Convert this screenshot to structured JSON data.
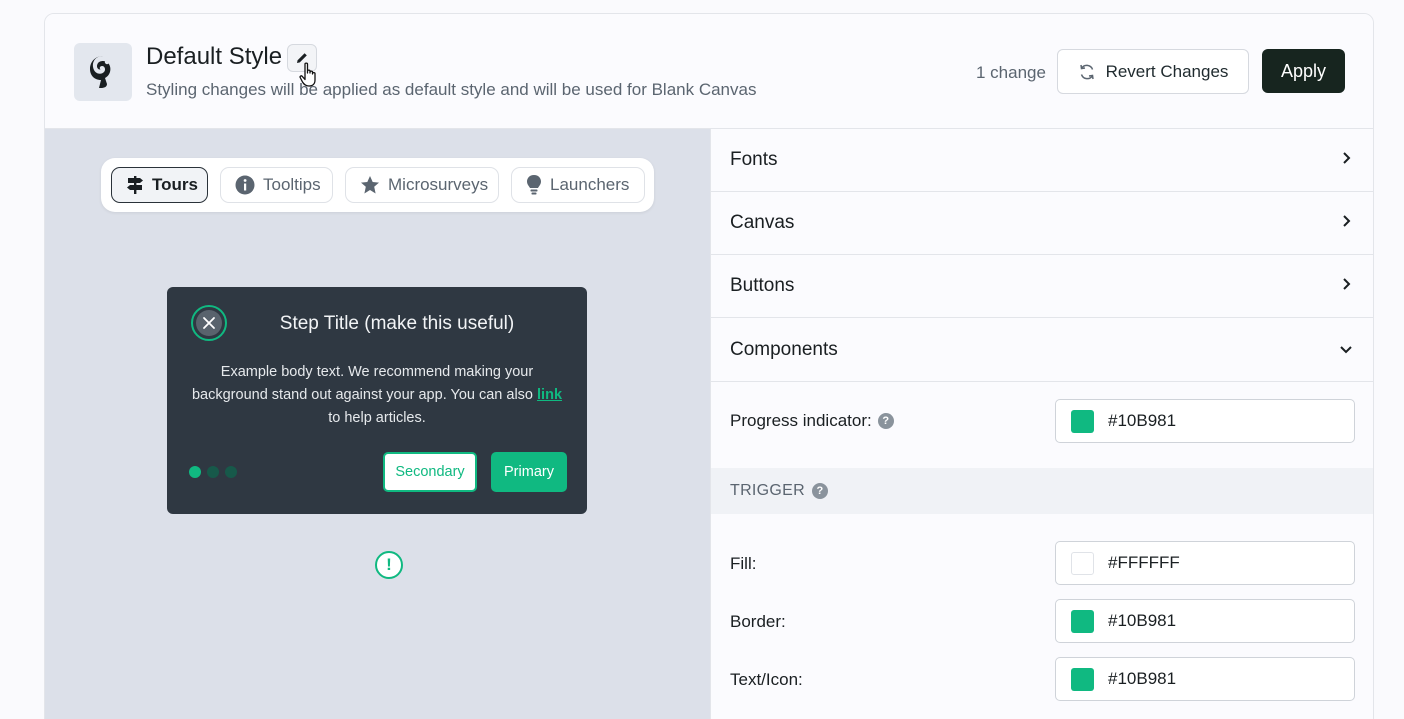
{
  "header": {
    "title": "Default Style",
    "subtitle": "Styling changes will be applied as default style and will be used for Blank Canvas",
    "change_count": "1 change",
    "revert_label": "Revert Changes",
    "apply_label": "Apply"
  },
  "preview": {
    "tabs": [
      {
        "label": "Tours",
        "icon": "signpost-icon",
        "active": true
      },
      {
        "label": "Tooltips",
        "icon": "info-icon",
        "active": false
      },
      {
        "label": "Microsurveys",
        "icon": "star-icon",
        "active": false
      },
      {
        "label": "Launchers",
        "icon": "lightbulb-icon",
        "active": false
      }
    ],
    "step": {
      "title": "Step Title (make this useful)",
      "body_before_link": "Example body text. We recommend making your background stand out against your app. You can also ",
      "link_text": "link",
      "body_after_link": " to help articles.",
      "secondary_label": "Secondary",
      "primary_label": "Primary",
      "progress_current": 1,
      "progress_total": 3
    },
    "trigger_symbol": "!"
  },
  "panel": {
    "sections": [
      {
        "label": "Fonts",
        "expanded": false
      },
      {
        "label": "Canvas",
        "expanded": false
      },
      {
        "label": "Buttons",
        "expanded": false
      },
      {
        "label": "Components",
        "expanded": true
      }
    ],
    "progress_indicator": {
      "label": "Progress indicator:",
      "value": "#10B981"
    },
    "trigger_heading": "TRIGGER",
    "trigger_fields": [
      {
        "label": "Fill:",
        "value": "#FFFFFF"
      },
      {
        "label": "Border:",
        "value": "#10B981"
      },
      {
        "label": "Text/Icon:",
        "value": "#10B981"
      }
    ]
  },
  "colors": {
    "accent": "#10B981",
    "apply_bg": "#17251F",
    "card_bg": "#2F3842",
    "preview_bg": "#DCE0E9"
  }
}
